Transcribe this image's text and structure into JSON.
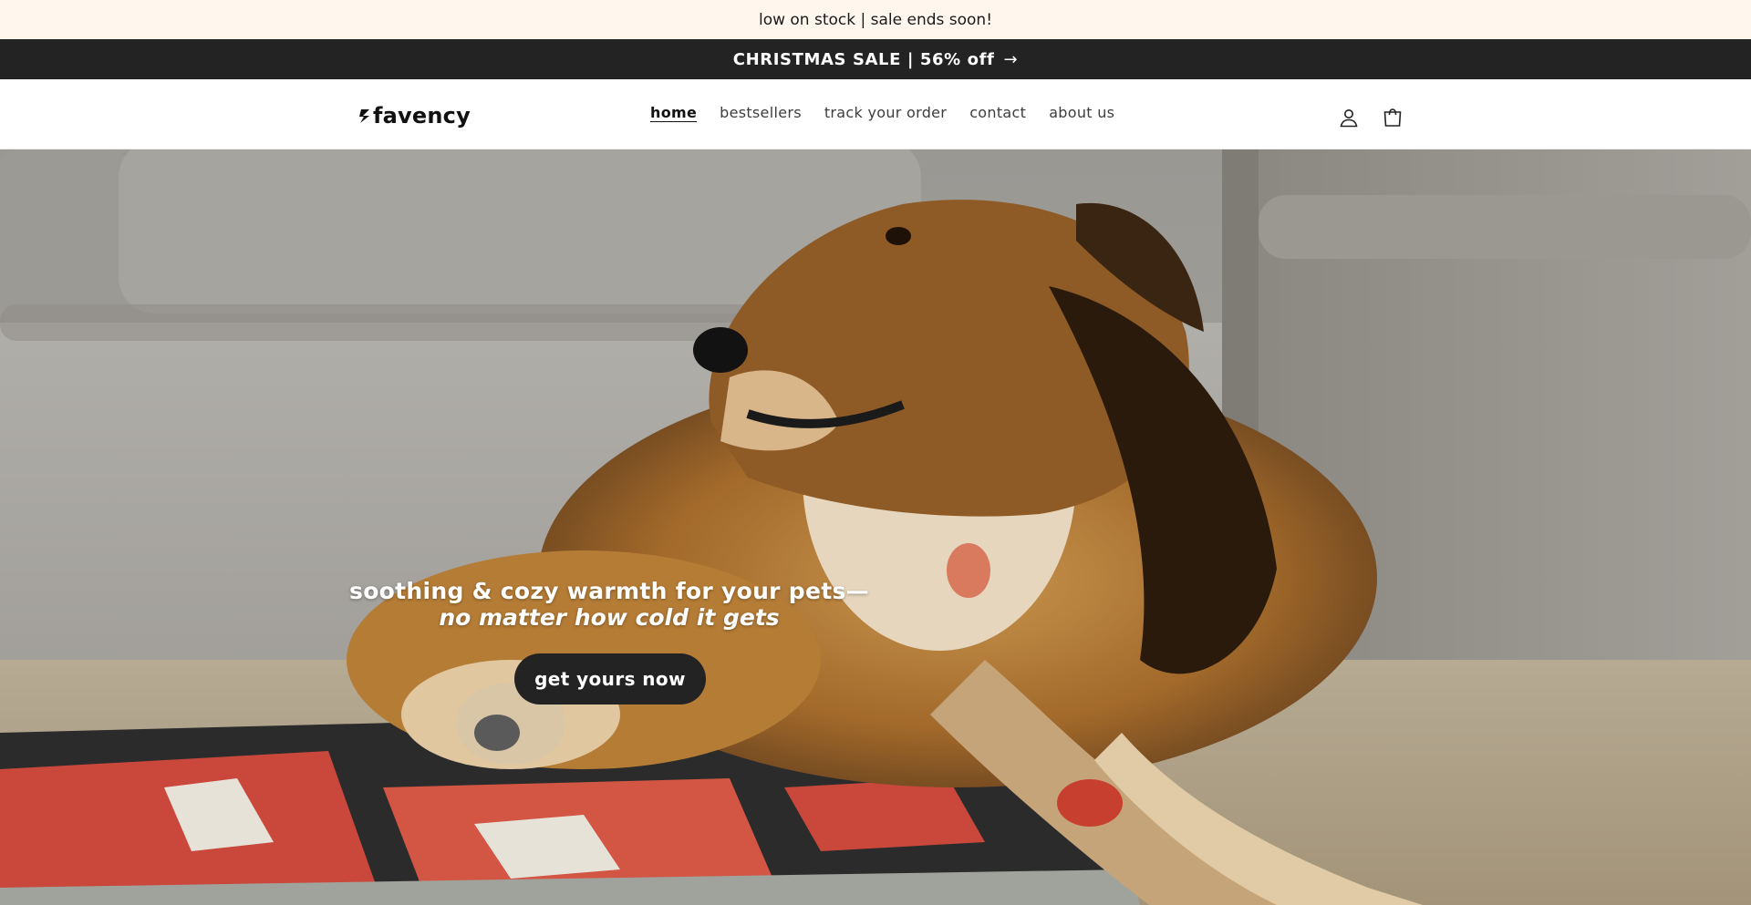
{
  "announcement": {
    "text": "low on stock | sale ends soon!"
  },
  "sale_banner": {
    "text": "CHRISTMAS SALE | 56% off",
    "arrow": "→"
  },
  "header": {
    "logo_text": "favency",
    "nav": [
      {
        "label": "home",
        "active": true
      },
      {
        "label": "bestsellers",
        "active": false
      },
      {
        "label": "track your order",
        "active": false
      },
      {
        "label": "contact",
        "active": false
      },
      {
        "label": "about us",
        "active": false
      }
    ],
    "icons": [
      "account-icon",
      "cart-icon"
    ]
  },
  "hero": {
    "headline": "soothing & cozy warmth for your pets—",
    "subheadline": "no matter how cold it gets",
    "cta_label": "get yours now"
  },
  "colors": {
    "announcement_bg": "#fff7ee",
    "sale_bg": "#232323",
    "button_bg": "#232323",
    "text_dark": "#111111"
  }
}
